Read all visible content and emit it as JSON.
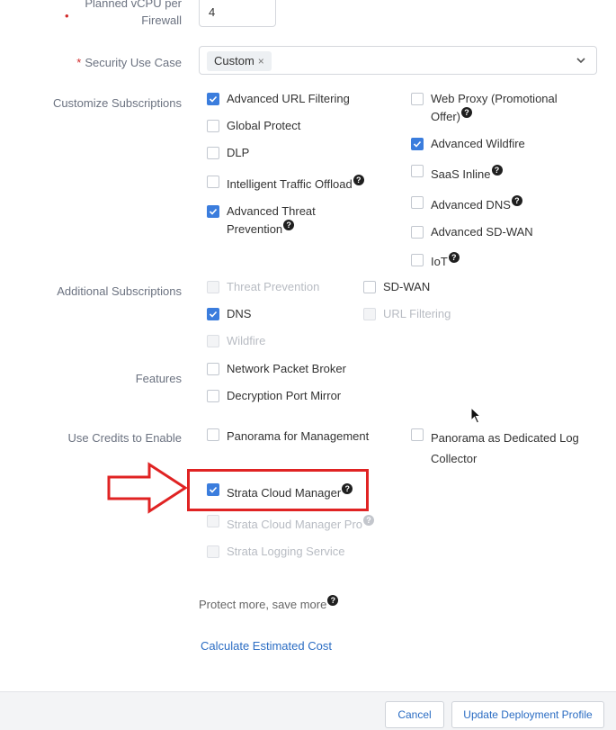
{
  "vcpu": {
    "label_line1": "Planned vCPU per",
    "label_line2": "Firewall",
    "value": "4"
  },
  "security_use_case": {
    "label": "Security Use Case",
    "chip": "Custom",
    "chip_remove": "×"
  },
  "customize_subscriptions": {
    "label": "Customize Subscriptions",
    "left": [
      {
        "label": "Advanced URL Filtering",
        "checked": true,
        "help": false
      },
      {
        "label": "Global Protect",
        "checked": false,
        "help": false
      },
      {
        "label": "DLP",
        "checked": false,
        "help": false
      },
      {
        "label": "Intelligent Traffic Offload",
        "checked": false,
        "help": true
      },
      {
        "label_line1": "Advanced Threat",
        "label_line2": "Prevention",
        "checked": true,
        "help": true
      }
    ],
    "right": [
      {
        "label_line1": "Web Proxy (Promotional",
        "label_line2": "Offer)",
        "checked": false,
        "help": true
      },
      {
        "label": "Advanced Wildfire",
        "checked": true,
        "help": false
      },
      {
        "label": "SaaS Inline",
        "checked": false,
        "help": true
      },
      {
        "label": "Advanced DNS",
        "checked": false,
        "help": true
      },
      {
        "label": "Advanced SD-WAN",
        "checked": false,
        "help": false
      },
      {
        "label": "IoT",
        "checked": false,
        "help": true
      }
    ]
  },
  "additional_subscriptions": {
    "label": "Additional Subscriptions",
    "items": [
      {
        "label": "Threat Prevention",
        "checked": false,
        "disabled": true
      },
      {
        "label": "SD-WAN",
        "checked": false,
        "disabled": false
      },
      {
        "label": "DNS",
        "checked": true,
        "disabled": false
      },
      {
        "label": "URL Filtering",
        "checked": false,
        "disabled": true
      },
      {
        "label": "Wildfire",
        "checked": false,
        "disabled": true
      }
    ]
  },
  "features": {
    "label": "Features",
    "items": [
      {
        "label": "Network Packet Broker",
        "checked": false
      },
      {
        "label": "Decryption Port Mirror",
        "checked": false
      }
    ]
  },
  "credits": {
    "label": "Use Credits to Enable",
    "panorama_mgmt": "Panorama for Management",
    "panorama_log_line1": "Panorama as Dedicated Log",
    "panorama_log_line2": "Collector",
    "strata_cloud_manager": "Strata Cloud Manager",
    "strata_cloud_manager_pro": "Strata Cloud Manager Pro",
    "strata_logging_service": "Strata Logging Service"
  },
  "protect_more": "Protect more, save more",
  "calculate_link": "Calculate Estimated Cost",
  "help_glyph": "?",
  "footer": {
    "cancel": "Cancel",
    "update": "Update Deployment Profile"
  },
  "colors": {
    "accent": "#3b7ddd",
    "link": "#2a6cc3",
    "highlight": "#e02323"
  }
}
